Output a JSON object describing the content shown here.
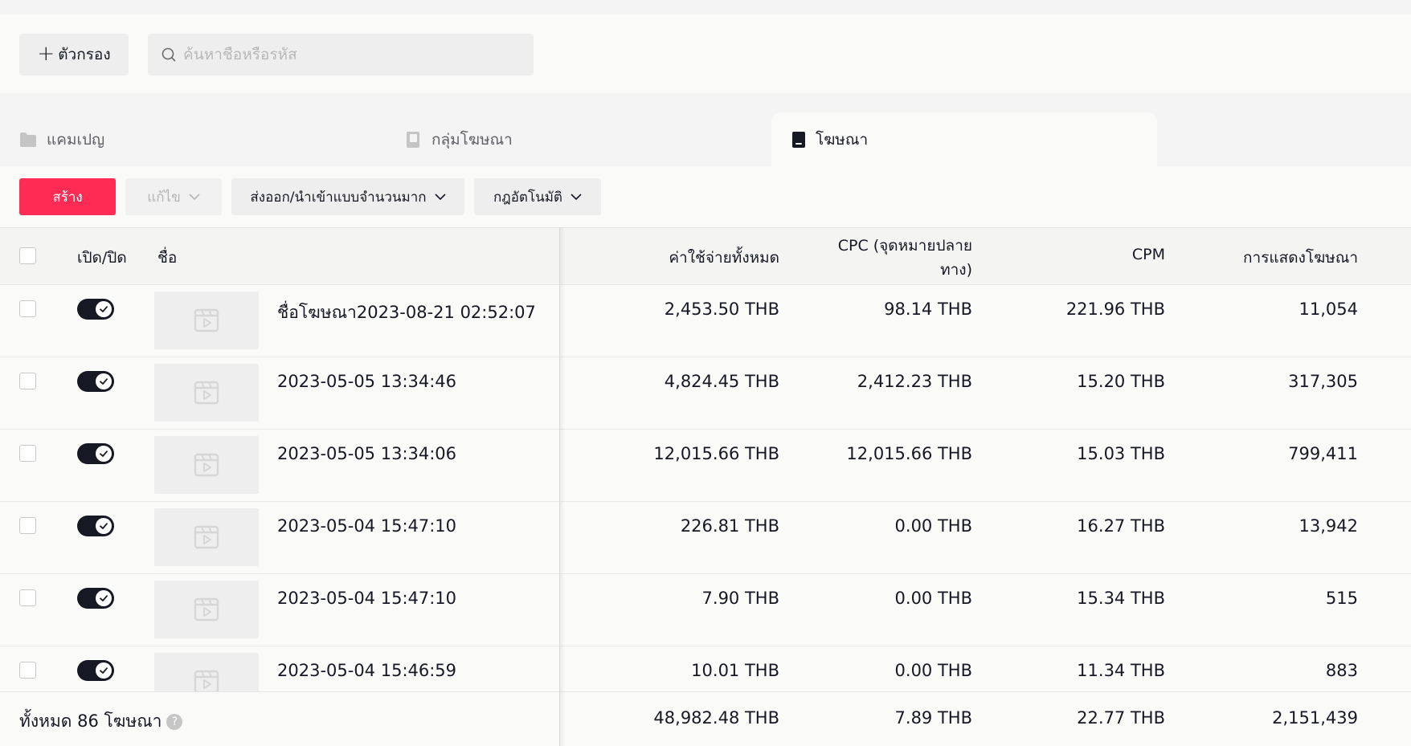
{
  "filter_bar": {
    "filter_button": "ตัวกรอง",
    "search_placeholder": "ค้นหาชื่อหรือรหัส"
  },
  "tabs": [
    {
      "label": "แคมเปญ",
      "active": false,
      "icon": "folder-icon"
    },
    {
      "label": "กลุ่มโฆษณา",
      "active": false,
      "icon": "ad-group-icon"
    },
    {
      "label": "โฆษณา",
      "active": true,
      "icon": "ad-icon"
    }
  ],
  "toolbar": {
    "create": "สร้าง",
    "edit": "แก้ไข",
    "bulk_export_import": "ส่งออก/นำเข้าแบบจำนวนมาก",
    "automated_rules": "กฎอัตโนมัติ"
  },
  "table": {
    "columns": {
      "toggle": "เปิด/ปิด",
      "name": "ชื่อ",
      "total_cost": "ค่าใช้จ่ายทั้งหมด",
      "cpc_line1": "CPC (จุดหมายปลาย",
      "cpc_line2": "ทาง)",
      "cpm": "CPM",
      "impressions": "การแสดงโฆษณา"
    },
    "rows": [
      {
        "name": "ชื่อโฆษณา2023-08-21 02:52:07",
        "on": true,
        "total_cost": "2,453.50 THB",
        "cpc": "98.14 THB",
        "cpm": "221.96 THB",
        "impressions": "11,054"
      },
      {
        "name": "2023-05-05 13:34:46",
        "on": true,
        "total_cost": "4,824.45 THB",
        "cpc": "2,412.23 THB",
        "cpm": "15.20 THB",
        "impressions": "317,305"
      },
      {
        "name": "2023-05-05 13:34:06",
        "on": true,
        "total_cost": "12,015.66 THB",
        "cpc": "12,015.66 THB",
        "cpm": "15.03 THB",
        "impressions": "799,411"
      },
      {
        "name": "2023-05-04 15:47:10",
        "on": true,
        "total_cost": "226.81 THB",
        "cpc": "0.00 THB",
        "cpm": "16.27 THB",
        "impressions": "13,942"
      },
      {
        "name": "2023-05-04 15:47:10",
        "on": true,
        "total_cost": "7.90 THB",
        "cpc": "0.00 THB",
        "cpm": "15.34 THB",
        "impressions": "515"
      },
      {
        "name": "2023-05-04 15:46:59",
        "on": true,
        "total_cost": "10.01 THB",
        "cpc": "0.00 THB",
        "cpm": "11.34 THB",
        "impressions": "883"
      }
    ],
    "footer": {
      "total_label": "ทั้งหมด 86 โฆษณา",
      "help": "?",
      "total_cost": "48,982.48 THB",
      "cpc": "7.89 THB",
      "cpm": "22.77 THB",
      "impressions": "2,151,439"
    }
  },
  "colors": {
    "primary": "#fe2c55",
    "toggle_on": "#161823"
  }
}
